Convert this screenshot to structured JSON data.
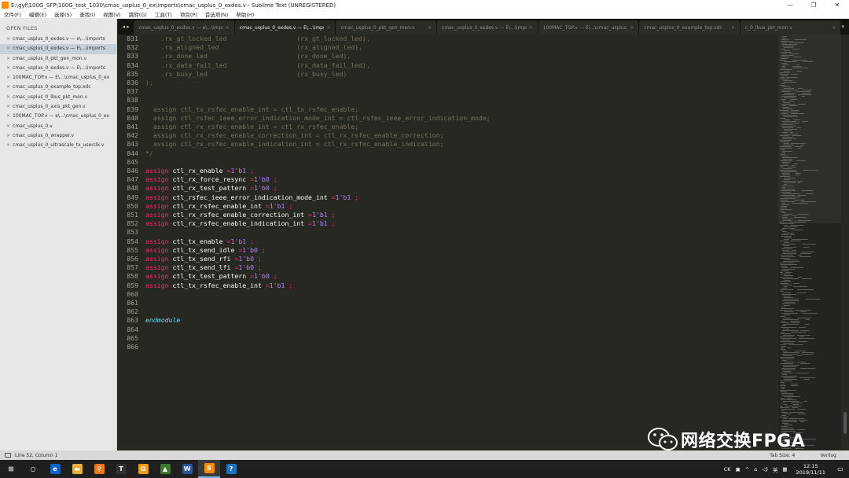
{
  "window": {
    "title": "E:\\gyf\\100G_SFP\\100G_test_1030\\cmac_usplus_0_ex\\imports\\cmac_usplus_0_exdes.v - Sublime Text (UNREGISTERED)",
    "minimize": "—",
    "maximize": "❐",
    "close": "✕"
  },
  "menu": [
    "文件(F)",
    "编辑(E)",
    "选择(S)",
    "查找(I)",
    "视图(V)",
    "跳转(G)",
    "工具(T)",
    "项目(P)",
    "首选项(N)",
    "帮助(H)"
  ],
  "sidebar": {
    "header": "OPEN FILES",
    "items": [
      "cmac_usplus_0_exdes.v — e\\...\\imports",
      "cmac_usplus_0_exdes.v — E\\...\\imports",
      "cmac_usplus_0_pkt_gen_mon.v",
      "cmac_usplus_0_exdes.v — E\\...\\imports",
      "100MAC_TOP.v — E\\...\\cmac_usplus_0_ex",
      "cmac_usplus_0_example_top.xdc",
      "cmac_usplus_0_lbus_pkt_mon.v",
      "cmac_usplus_0_axis_pkt_gen.v",
      "100MAC_TOP.v — e\\...\\cmac_usplus_0_ex",
      "cmac_usplus_0.v",
      "cmac_usplus_0_wrapper.v",
      "cmac_usplus_0_ultrascale_tx_userclk.v"
    ],
    "active_index": 1
  },
  "tabs": [
    "cmac_usplus_0_exdes.v — e\\...\\imports",
    "cmac_usplus_0_exdes.v — E\\...\\imports",
    "cmac_usplus_0_pkt_gen_mon.v",
    "cmac_usplus_0_exdes.v — E\\...\\imports",
    "100MAC_TOP.v — E\\...\\cmac_usplus_0_ex",
    "cmac_usplus_0_example_top.xdc",
    "c_0_lbus_pkt_mon.v"
  ],
  "active_tab": 1,
  "code": [
    {
      "n": "831",
      "toks": [
        [
          "c",
          "    .rx_gt_locked_led                  (rx_gt_locked_led),"
        ]
      ]
    },
    {
      "n": "832",
      "toks": [
        [
          "c",
          "    .rx_aligned_led                    (rx_aligned_led),"
        ]
      ]
    },
    {
      "n": "833",
      "toks": [
        [
          "c",
          "    .rx_done_led                       (rx_done_led),"
        ]
      ]
    },
    {
      "n": "834",
      "toks": [
        [
          "c",
          "    .rx_data_fail_led                  (rx_data_fail_led),"
        ]
      ]
    },
    {
      "n": "835",
      "toks": [
        [
          "c",
          "    .rx_busy_led                       (rx_busy_led)"
        ]
      ]
    },
    {
      "n": "836",
      "toks": [
        [
          "c",
          ");"
        ]
      ]
    },
    {
      "n": "837",
      "toks": []
    },
    {
      "n": "838",
      "toks": []
    },
    {
      "n": "839",
      "toks": [
        [
          "c",
          "  assign ctl_tx_rsfec_enable_int = ctl_tx_rsfec_enable;"
        ]
      ]
    },
    {
      "n": "840",
      "toks": [
        [
          "c",
          "  assign ctl_rsfec_ieee_error_indication_mode_int = ctl_rsfec_ieee_error_indication_mode;"
        ]
      ]
    },
    {
      "n": "841",
      "toks": [
        [
          "c",
          "  assign ctl_rx_rsfec_enable_int = ctl_rx_rsfec_enable;"
        ]
      ]
    },
    {
      "n": "842",
      "toks": [
        [
          "c",
          "  assign ctl_rx_rsfec_enable_correction_int = ctl_rx_rsfec_enable_correction;"
        ]
      ]
    },
    {
      "n": "843",
      "toks": [
        [
          "c",
          "  assign ctl_rx_rsfec_enable_indication_int = ctl_rx_rsfec_enable_indication;"
        ]
      ]
    },
    {
      "n": "844",
      "toks": [
        [
          "c",
          "*/"
        ]
      ]
    },
    {
      "n": "845",
      "toks": []
    },
    {
      "n": "846",
      "toks": [
        [
          "k",
          "assign"
        ],
        [
          "i",
          " ctl_rx_enable "
        ],
        [
          "o",
          "="
        ],
        [
          "n",
          "1'b1"
        ],
        [
          "p",
          " "
        ],
        [
          "o",
          ";"
        ]
      ]
    },
    {
      "n": "847",
      "toks": [
        [
          "k",
          "assign"
        ],
        [
          "i",
          " ctl_rx_force_resync "
        ],
        [
          "o",
          "="
        ],
        [
          "n",
          "1'b0"
        ],
        [
          "p",
          " "
        ],
        [
          "o",
          ";"
        ]
      ]
    },
    {
      "n": "848",
      "toks": [
        [
          "k",
          "assign"
        ],
        [
          "i",
          " ctl_rx_test_pattern "
        ],
        [
          "o",
          "="
        ],
        [
          "n",
          "1'b0"
        ],
        [
          "p",
          " "
        ],
        [
          "o",
          ";"
        ]
      ]
    },
    {
      "n": "849",
      "toks": [
        [
          "k",
          "assign"
        ],
        [
          "i",
          " ctl_rsfec_ieee_error_indication_mode_int "
        ],
        [
          "o",
          "="
        ],
        [
          "n",
          "1'b1"
        ],
        [
          "p",
          " "
        ],
        [
          "o",
          ";"
        ]
      ]
    },
    {
      "n": "850",
      "toks": [
        [
          "k",
          "assign"
        ],
        [
          "i",
          " ctl_rx_rsfec_enable_int "
        ],
        [
          "o",
          "="
        ],
        [
          "n",
          "1'b1"
        ],
        [
          "p",
          " "
        ],
        [
          "o",
          ";"
        ]
      ]
    },
    {
      "n": "851",
      "toks": [
        [
          "k",
          "assign"
        ],
        [
          "i",
          " ctl_rx_rsfec_enable_correction_int "
        ],
        [
          "o",
          "="
        ],
        [
          "n",
          "1'b1"
        ],
        [
          "p",
          " "
        ],
        [
          "o",
          ";"
        ]
      ]
    },
    {
      "n": "852",
      "toks": [
        [
          "k",
          "assign"
        ],
        [
          "i",
          " ctl_rx_rsfec_enable_indication_int "
        ],
        [
          "o",
          "="
        ],
        [
          "n",
          "1'b1"
        ],
        [
          "p",
          " "
        ],
        [
          "o",
          ";"
        ]
      ]
    },
    {
      "n": "853",
      "toks": []
    },
    {
      "n": "854",
      "toks": [
        [
          "k",
          "assign"
        ],
        [
          "i",
          " ctl_tx_enable "
        ],
        [
          "o",
          "="
        ],
        [
          "n",
          "1'b1"
        ],
        [
          "p",
          " "
        ],
        [
          "o",
          ";"
        ]
      ]
    },
    {
      "n": "855",
      "toks": [
        [
          "k",
          "assign"
        ],
        [
          "i",
          " ctl_tx_send_idle "
        ],
        [
          "o",
          "="
        ],
        [
          "n",
          "1'b0"
        ],
        [
          "p",
          " "
        ],
        [
          "o",
          ";"
        ]
      ]
    },
    {
      "n": "856",
      "toks": [
        [
          "k",
          "assign"
        ],
        [
          "i",
          " ctl_tx_send_rfi "
        ],
        [
          "o",
          "="
        ],
        [
          "n",
          "1'b0"
        ],
        [
          "p",
          " "
        ],
        [
          "o",
          ";"
        ]
      ]
    },
    {
      "n": "857",
      "toks": [
        [
          "k",
          "assign"
        ],
        [
          "i",
          " ctl_tx_send_lfi "
        ],
        [
          "o",
          "="
        ],
        [
          "n",
          "1'b0"
        ],
        [
          "p",
          " "
        ],
        [
          "o",
          ";"
        ]
      ]
    },
    {
      "n": "858",
      "toks": [
        [
          "k",
          "assign"
        ],
        [
          "i",
          " ctl_tx_test_pattern "
        ],
        [
          "o",
          "="
        ],
        [
          "n",
          "1'b0"
        ],
        [
          "p",
          " "
        ],
        [
          "o",
          ";"
        ]
      ]
    },
    {
      "n": "859",
      "toks": [
        [
          "k",
          "assign"
        ],
        [
          "i",
          " ctl_tx_rsfec_enable_int "
        ],
        [
          "o",
          "="
        ],
        [
          "n",
          "1'b1"
        ],
        [
          "p",
          " "
        ],
        [
          "o",
          ";"
        ]
      ]
    },
    {
      "n": "860",
      "toks": []
    },
    {
      "n": "861",
      "toks": []
    },
    {
      "n": "862",
      "toks": []
    },
    {
      "n": "863",
      "toks": [
        [
          "e",
          "endmodule"
        ]
      ]
    },
    {
      "n": "864",
      "toks": []
    },
    {
      "n": "865",
      "toks": []
    },
    {
      "n": "866",
      "toks": []
    }
  ],
  "status": {
    "position": "Line 52, Column 1",
    "tab_size": "Tab Size: 4",
    "syntax": "Verilog"
  },
  "watermark": "网络交换FPGA",
  "taskbar": {
    "apps": [
      {
        "icon": "windows-start-icon",
        "glyph": "⊞",
        "color": "#1f1f1f"
      },
      {
        "icon": "cortana-search-icon",
        "glyph": "○",
        "color": "#1f1f1f"
      },
      {
        "icon": "edge-browser-icon",
        "glyph": "e",
        "color": "#0a64c8"
      },
      {
        "icon": "file-explorer-icon",
        "glyph": "▬",
        "color": "#e8b23a"
      },
      {
        "icon": "search-app-icon",
        "glyph": "⚲",
        "color": "#f07a1a"
      },
      {
        "icon": "typora-icon",
        "glyph": "T",
        "color": "#333333"
      },
      {
        "icon": "orange-app-icon",
        "glyph": "G",
        "color": "#f39c12"
      },
      {
        "icon": "vivado-icon",
        "glyph": "▲",
        "color": "#3a7a2a"
      },
      {
        "icon": "word-icon",
        "glyph": "W",
        "color": "#2b579a"
      },
      {
        "icon": "sublime-text-icon",
        "glyph": "S",
        "color": "#ff8a00"
      },
      {
        "icon": "help-icon",
        "glyph": "?",
        "color": "#1e73be"
      }
    ],
    "active_index": 9,
    "tray_text": "CK",
    "ime": "英",
    "time": "12:15",
    "date": "2019/11/11"
  }
}
